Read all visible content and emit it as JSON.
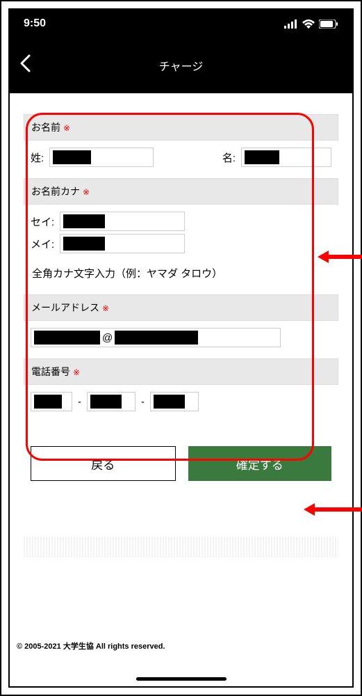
{
  "status": {
    "time": "9:50"
  },
  "nav": {
    "title": "チャージ"
  },
  "form": {
    "name": {
      "section_label": "お名前",
      "last_label": "姓:",
      "first_label": "名:"
    },
    "kana": {
      "section_label": "お名前カナ",
      "sei_label": "セイ:",
      "mei_label": "メイ:",
      "hint": "全角カナ文字入力（例：ヤマダ タロウ）"
    },
    "email": {
      "section_label": "メールアドレス",
      "at": "@"
    },
    "phone": {
      "section_label": "電話番号",
      "sep": "-"
    }
  },
  "buttons": {
    "back": "戻る",
    "confirm": "確定する"
  },
  "footer": "© 2005-2021 大学生協 All rights reserved."
}
